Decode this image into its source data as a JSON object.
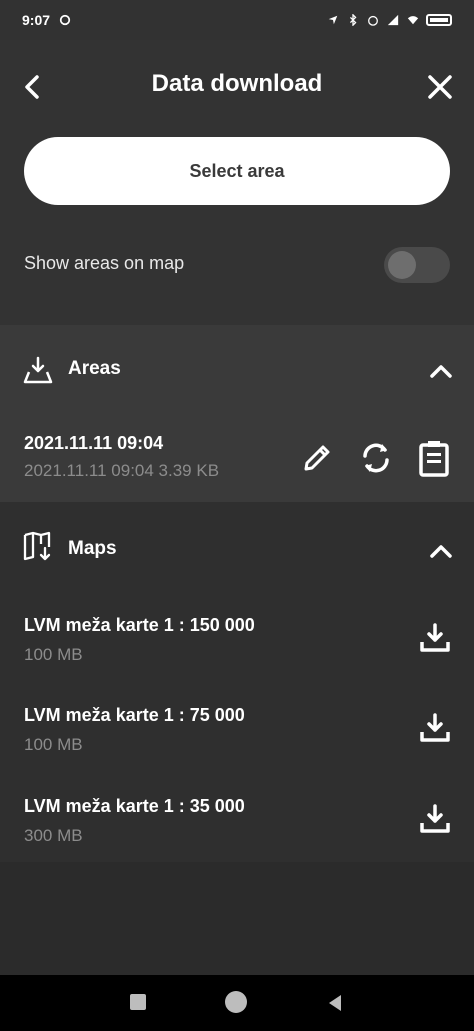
{
  "status_bar": {
    "time": "9:07",
    "icons": [
      "sync-icon",
      "location-icon",
      "bluetooth-icon",
      "alarm-icon",
      "signal-icon",
      "wifi-icon",
      "battery-icon"
    ]
  },
  "header": {
    "title": "Data download",
    "back_icon": "chevron-left-icon",
    "close_icon": "close-icon"
  },
  "select_area_button": "Select area",
  "show_areas": {
    "label": "Show areas on map",
    "toggle_on": false
  },
  "areas": {
    "title": "Areas",
    "items": [
      {
        "title": "2021.11.11 09:04",
        "subtitle": "2021.11.11 09:04 3.39 KB"
      }
    ]
  },
  "maps": {
    "title": "Maps",
    "items": [
      {
        "title": "LVM meža karte 1 : 150 000",
        "size": "100 MB"
      },
      {
        "title": "LVM meža karte 1 : 75 000",
        "size": "100 MB"
      },
      {
        "title": "LVM meža karte 1 : 35 000",
        "size": "300 MB"
      }
    ]
  },
  "colors": {
    "background": "#2f2f2f",
    "panel": "#333333",
    "areas_panel": "#3a3a3a",
    "button_bg": "#ffffff",
    "secondary_text": "#8c8c8c"
  }
}
